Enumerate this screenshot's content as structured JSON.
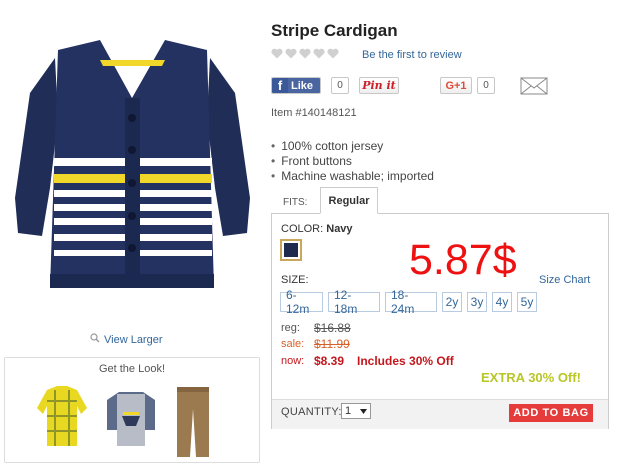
{
  "product": {
    "title": "Stripe Cardigan",
    "review_link": "Be the first to review",
    "rating_hearts": 5,
    "item_number": "Item #140148121",
    "features": [
      "100% cotton jersey",
      "Front buttons",
      "Machine washable; imported"
    ],
    "view_larger": "View Larger"
  },
  "social": {
    "facebook_label": "Like",
    "facebook_icon_letter": "f",
    "facebook_count": "0",
    "pinterest_label": "Pin it",
    "gplus_label": "G+1",
    "gplus_count": "0"
  },
  "fits": {
    "label": "FITS:",
    "selected": "Regular"
  },
  "color": {
    "label": "COLOR:",
    "selected": "Navy",
    "swatch_hex": "#1e2b4f"
  },
  "overlay_price": "5.87$",
  "size": {
    "label": "SIZE:",
    "chart_link": "Size Chart",
    "options": [
      "6-12m",
      "12-18m",
      "18-24m",
      "2y",
      "3y",
      "4y",
      "5y"
    ]
  },
  "pricing": {
    "reg_label": "reg:",
    "reg_value": "$16.88",
    "sale_label": "sale:",
    "sale_value": "$11.99",
    "now_label": "now:",
    "now_value": "$8.39",
    "includes": "Includes 30% Off",
    "extra": "EXTRA 30% Off!"
  },
  "purchase": {
    "quantity_label": "QUANTITY:",
    "quantity_value": "1",
    "add_to_bag": "ADD TO BAG"
  },
  "get_the_look": {
    "title": "Get the Look!"
  },
  "colors": {
    "link": "#336699",
    "now_red": "#c4171d",
    "sale_orange": "#d8612a",
    "extra_green": "#b8c626",
    "add_button": "#e63b3b",
    "overlay_red": "#ee1111"
  }
}
